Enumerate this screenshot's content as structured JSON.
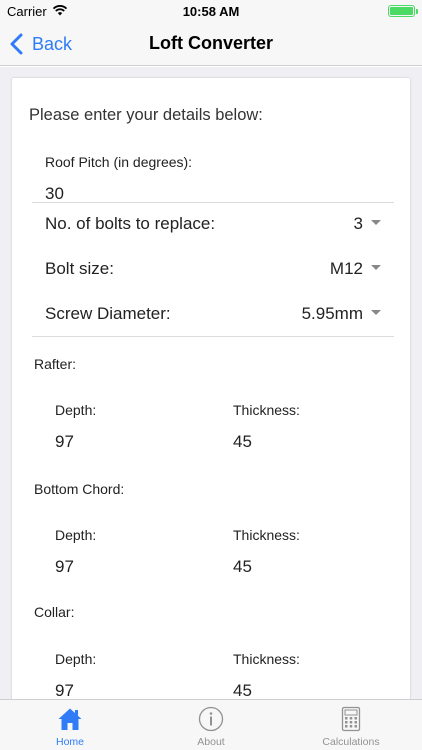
{
  "status_bar": {
    "carrier": "Carrier",
    "time": "10:58 AM"
  },
  "nav": {
    "back_label": "Back",
    "title": "Loft Converter"
  },
  "form": {
    "intro": "Please enter your details below:",
    "roof_pitch": {
      "label": "Roof Pitch (in degrees):",
      "value": "30"
    },
    "bolts": {
      "label": "No. of bolts to replace:",
      "value": "3"
    },
    "bolt_size": {
      "label": "Bolt size:",
      "value": "M12"
    },
    "screw_diameter": {
      "label": "Screw Diameter:",
      "value": "5.95mm"
    },
    "rafter": {
      "title": "Rafter:",
      "depth_label": "Depth:",
      "depth": "97",
      "thickness_label": "Thickness:",
      "thickness": "45"
    },
    "bottom_chord": {
      "title": "Bottom Chord:",
      "depth_label": "Depth:",
      "depth": "97",
      "thickness_label": "Thickness:",
      "thickness": "45"
    },
    "collar": {
      "title": "Collar:",
      "depth_label": "Depth:",
      "depth": "97",
      "thickness_label": "Thickness:",
      "thickness": "45"
    }
  },
  "tabs": [
    {
      "label": "Home",
      "icon": "home-icon",
      "active": true
    },
    {
      "label": "About",
      "icon": "info-icon",
      "active": false
    },
    {
      "label": "Calculations",
      "icon": "calculator-icon",
      "active": false
    }
  ],
  "colors": {
    "accent": "#2f7cf6",
    "inactive": "#929292",
    "battery": "#4cd964",
    "background": "#efeff4"
  }
}
